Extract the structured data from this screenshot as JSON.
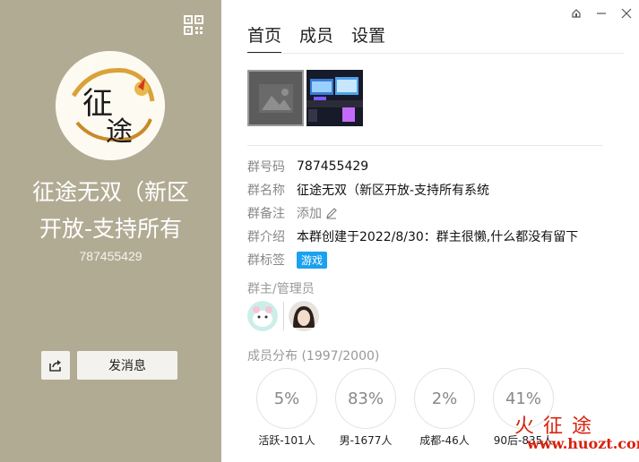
{
  "left": {
    "group_title_line1": "征途无双（新区",
    "group_title_line2": "开放-支持所有",
    "group_id": "787455429",
    "send_message_label": "发消息"
  },
  "tabs": [
    "首页",
    "成员",
    "设置"
  ],
  "info": {
    "number_label": "群号码",
    "number_value": "787455429",
    "name_label": "群名称",
    "name_value": "征途无双（新区开放-支持所有系统",
    "remark_label": "群备注",
    "remark_value": "添加",
    "intro_label": "群介绍",
    "intro_value": "本群创建于2022/8/30：群主很懒,什么都没有留下",
    "tag_label": "群标签",
    "tag_value": "游戏"
  },
  "admins_title": "群主/管理员",
  "distribution_title": "成员分布 (1997/2000)",
  "stats": [
    {
      "percent": "5%",
      "label": "活跃-101人"
    },
    {
      "percent": "83%",
      "label": "男-1677人"
    },
    {
      "percent": "2%",
      "label": "成都-46人"
    },
    {
      "percent": "41%",
      "label": "90后-835人"
    }
  ],
  "watermark": {
    "cn": "火征途",
    "en": "www.huozt.com"
  },
  "colors": {
    "left_panel": "#b2ab94",
    "tag": "#1aa1f0",
    "watermark": "#d8200c"
  }
}
